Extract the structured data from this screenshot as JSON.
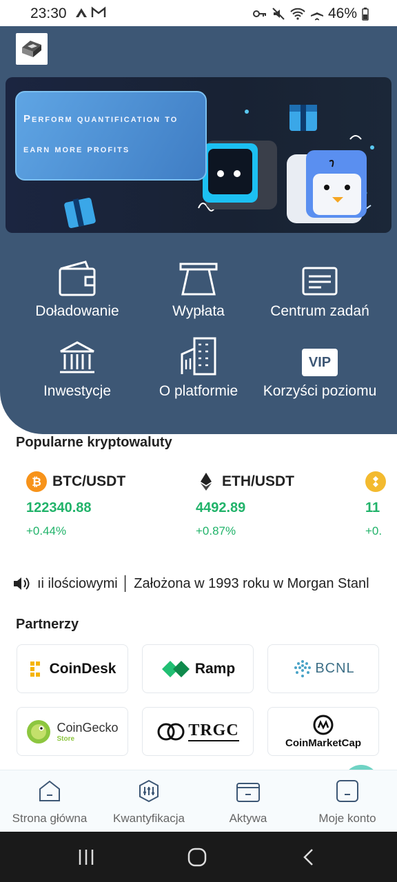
{
  "status_bar": {
    "time": "23:30",
    "battery": "46%"
  },
  "banner": {
    "line1": "Perform quantification to",
    "line2": "earn more profits"
  },
  "actions": [
    {
      "label": "Doładowanie",
      "icon": "wallet-icon"
    },
    {
      "label": "Wypłata",
      "icon": "withdraw-icon"
    },
    {
      "label": "Centrum zadań",
      "icon": "task-card-icon"
    },
    {
      "label": "Inwestycje",
      "icon": "bank-icon"
    },
    {
      "label": "O platformie",
      "icon": "building-icon"
    },
    {
      "label": "Korzyści poziomu",
      "icon": "vip-icon"
    }
  ],
  "vip_text": "VIP",
  "popular": {
    "title": "Popularne kryptowaluty",
    "coins": [
      {
        "pair": "BTC/USDT",
        "price": "122340.88",
        "change": "+0.44%",
        "icon": "btc-icon"
      },
      {
        "pair": "ETH/USDT",
        "price": "4492.89",
        "change": "+0.87%",
        "icon": "eth-icon"
      },
      {
        "pair": "",
        "price": "11",
        "change": "+0.",
        "icon": "bnb-icon"
      }
    ]
  },
  "ticker": {
    "text": "ıi ilościowymi │ Założona w 1993 roku w Morgan Stanl"
  },
  "partners": {
    "title": "Partnerzy",
    "items": [
      {
        "name": "CoinDesk"
      },
      {
        "name": "Ramp"
      },
      {
        "name": "BCNL"
      },
      {
        "name": "CoinGecko",
        "sub": "Store"
      },
      {
        "name": "TRGC"
      },
      {
        "name": "CoinMarketCap"
      }
    ]
  },
  "bottom_nav": [
    {
      "label": "Strona główna",
      "icon": "home-icon"
    },
    {
      "label": "Kwantyfikacja",
      "icon": "quantify-icon"
    },
    {
      "label": "Aktywa",
      "icon": "assets-wallet-icon"
    },
    {
      "label": "Moje konto",
      "icon": "account-icon"
    }
  ],
  "colors": {
    "hero_bg": "#3d5775",
    "price_green": "#21b36a",
    "btc": "#f7931a",
    "bnb": "#f3ba2f"
  }
}
